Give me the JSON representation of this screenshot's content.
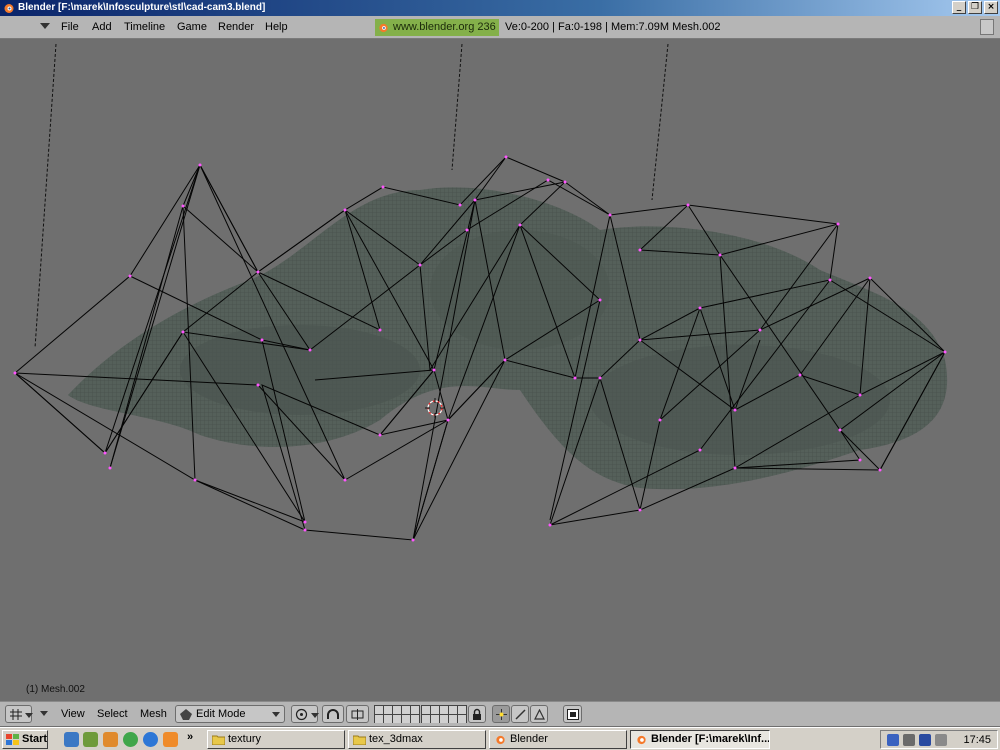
{
  "window": {
    "title": "Blender [F:\\marek\\Infosculpture\\stl\\cad-cam3.blend]",
    "controls": [
      "_",
      "❐",
      "×"
    ]
  },
  "info_header": {
    "menus": [
      "File",
      "Add",
      "Timeline",
      "Game",
      "Render",
      "Help"
    ],
    "site_badge": "www.blender.org 236",
    "stats": "Ve:0-200 | Fa:0-198 | Mem:7.09M Mesh.002",
    "badge_color": "#84b04a"
  },
  "viewport": {
    "object_label": "(1) Mesh.002",
    "background_color": "#6f6f6f",
    "vertex_color": "#ff55ff"
  },
  "view_header": {
    "menus": [
      "View",
      "Select",
      "Mesh"
    ],
    "mode": "Edit Mode",
    "icons": [
      "view-type-icon",
      "pivot-icon",
      "proportional-edit-icon",
      "snap-icon",
      "lock-icon",
      "vertex-select-icon",
      "edge-select-icon",
      "face-select-icon",
      "render-preview-icon"
    ]
  },
  "taskbar": {
    "start_label": "Start",
    "tasks": [
      {
        "label": "textury",
        "icon": "folder-icon",
        "active": false
      },
      {
        "label": "tex_3dmax",
        "icon": "folder-icon",
        "active": false
      },
      {
        "label": "Blender",
        "icon": "blender-icon",
        "active": false
      },
      {
        "label": "Blender [F:\\marek\\Inf...",
        "icon": "blender-icon",
        "active": true
      }
    ],
    "quicklaunch_more": "»",
    "clock": "17:45"
  }
}
